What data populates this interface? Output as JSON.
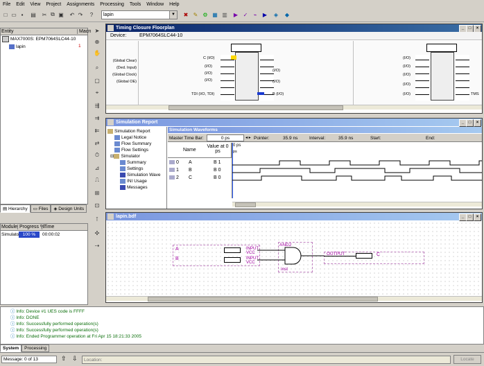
{
  "menu": [
    "File",
    "Edit",
    "View",
    "Project",
    "Assignments",
    "Processing",
    "Tools",
    "Window",
    "Help"
  ],
  "toolbar": {
    "project_combo": "lapin"
  },
  "hierarchy": {
    "col_entity": "Entity",
    "col_macro": "Macro",
    "device": "MAX7000S: EPM7064SLC44-10",
    "top": "lapin",
    "top_count": "1"
  },
  "left_tabs": [
    "Hierarchy",
    "Files",
    "Design Units"
  ],
  "status_table": {
    "col_module": "Module",
    "col_progress": "Progress %",
    "col_time": "Time",
    "module": "Simulator",
    "progress": "100 %",
    "time": "00:00:02"
  },
  "floorplan": {
    "title": "Timing Closure Floorplan",
    "device_label": "Device:",
    "device": "EPM7064SLC44-10",
    "left_labels": [
      "(Global Clear)",
      "(Ded. Input)",
      "(Global Clock)",
      "(Global OE)"
    ],
    "io_label_c": "C (I/O)",
    "io_label_tdi": "TDI (I/O, TDI)",
    "io_label_b": "B (I/O)",
    "io": "(I/O)",
    "tms": "TMS"
  },
  "simreport": {
    "title": "Simulation Report",
    "tree": [
      "Simulation Report",
      "Legal Notice",
      "Flow Summary",
      "Flow Settings",
      "Simulator",
      "Summary",
      "Settings",
      "Simulation Wave",
      "INI Usage",
      "Messages"
    ],
    "wave_title": "Simulation Waveforms",
    "master_label": "Master Time Bar:",
    "master_value": "0 ps",
    "pointer_label": "Pointer:",
    "pointer_value": "35.9 ns",
    "interval_label": "Interval:",
    "interval_value": "35.9 ns",
    "start_label": "Start:",
    "end_label": "End:",
    "col_name": "Name",
    "col_value": "Value at 0 ps",
    "time_marker": "0 ps",
    "time_marker2": "ps",
    "signals": [
      {
        "num": "0",
        "name": "A",
        "value": "B 1"
      },
      {
        "num": "1",
        "name": "B",
        "value": "B 0"
      },
      {
        "num": "2",
        "name": "C",
        "value": "B 0"
      }
    ]
  },
  "bdf": {
    "title": "lapin.bdf",
    "pin_a": "A",
    "pin_b": "B",
    "input": "INPUT",
    "vcc": "VCC",
    "gate": "AND2",
    "inst": "inst",
    "output": "OUTPUT",
    "pin_c": "C"
  },
  "messages": [
    "Info: Device #1 UES code is FFFF",
    "Info: DONE",
    "Info: Successfully performed operation(s)",
    "Info: Successfully performed operation(s)",
    "Info: Ended Programmer operation at Fri Apr 15 18:21:33 2005"
  ],
  "msg_tabs": [
    "System",
    "Processing"
  ],
  "statusbar": {
    "message": "Message: 0 of 13",
    "location_placeholder": "Location:",
    "locate": "Locate"
  }
}
